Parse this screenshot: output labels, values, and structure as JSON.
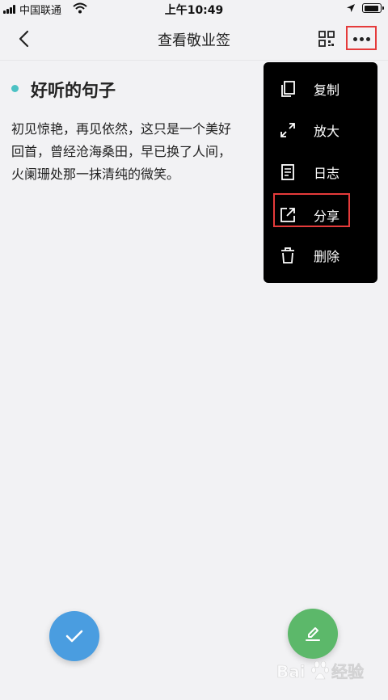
{
  "status_bar": {
    "carrier": "中国联通",
    "time": "上午10:49"
  },
  "nav": {
    "title": "查看敬业签"
  },
  "note": {
    "title": "好听的句子",
    "body_lines": [
      "初见惊艳，再见依然，这只是一个美好",
      "回首，曾经沧海桑田，早已换了人间，",
      "火阑珊处那一抹清纯的微笑。"
    ]
  },
  "menu": {
    "items": [
      {
        "label": "复制",
        "icon": "copy-icon"
      },
      {
        "label": "放大",
        "icon": "expand-icon"
      },
      {
        "label": "日志",
        "icon": "log-icon"
      },
      {
        "label": "分享",
        "icon": "share-icon"
      },
      {
        "label": "删除",
        "icon": "trash-icon"
      }
    ]
  },
  "colors": {
    "accent_dot": "#4cc2c4",
    "check_button": "#4a9de0",
    "edit_button": "#5cb86a",
    "highlight_box": "#e53b3b"
  }
}
